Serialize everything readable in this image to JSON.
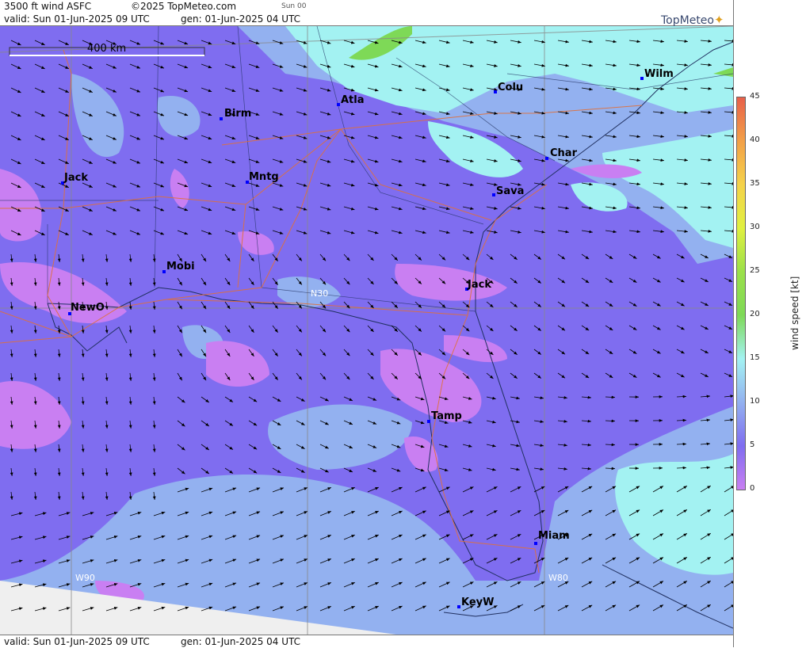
{
  "header": {
    "title": "3500 ft wind ASFC",
    "copyright": "©2025 TopMeteo.com",
    "day": "Sun 00",
    "valid": "valid:  Sun  01-Jun-2025  09 UTC",
    "gen": "gen: 01-Jun-2025 04 UTC"
  },
  "footer": {
    "valid": "valid:  Sun  01-Jun-2025  09 UTC",
    "gen": "gen: 01-Jun-2025 04 UTC"
  },
  "logo": {
    "text": "TopMeteo"
  },
  "map": {
    "scale_label": "400 km",
    "grid_labels": {
      "lat": "N30",
      "lon1": "W90",
      "lon2": "W80"
    },
    "cities": [
      {
        "name": "Birm"
      },
      {
        "name": "Atla"
      },
      {
        "name": "Colu"
      },
      {
        "name": "Wilm"
      },
      {
        "name": "Jack"
      },
      {
        "name": "Mntg"
      },
      {
        "name": "Char"
      },
      {
        "name": "Sava"
      },
      {
        "name": "Mobi"
      },
      {
        "name": "Jack"
      },
      {
        "name": "NewO"
      },
      {
        "name": "Tamp"
      },
      {
        "name": "Miam"
      },
      {
        "name": "KeyW"
      }
    ]
  },
  "colorbar": {
    "label": "wind speed [kt]",
    "ticks": [
      "45",
      "40",
      "35",
      "30",
      "25",
      "20",
      "15",
      "10",
      "5",
      "0"
    ],
    "colors": {
      "c0": "#c97ff2",
      "c5": "#7f6df0",
      "c10": "#93b1f0",
      "c15": "#a3f2f2",
      "c20": "#7ed957",
      "c25": "#9be04a",
      "c30": "#e0f040",
      "c35": "#f5d24a",
      "c40": "#f2a048",
      "c45": "#e8604a"
    }
  }
}
